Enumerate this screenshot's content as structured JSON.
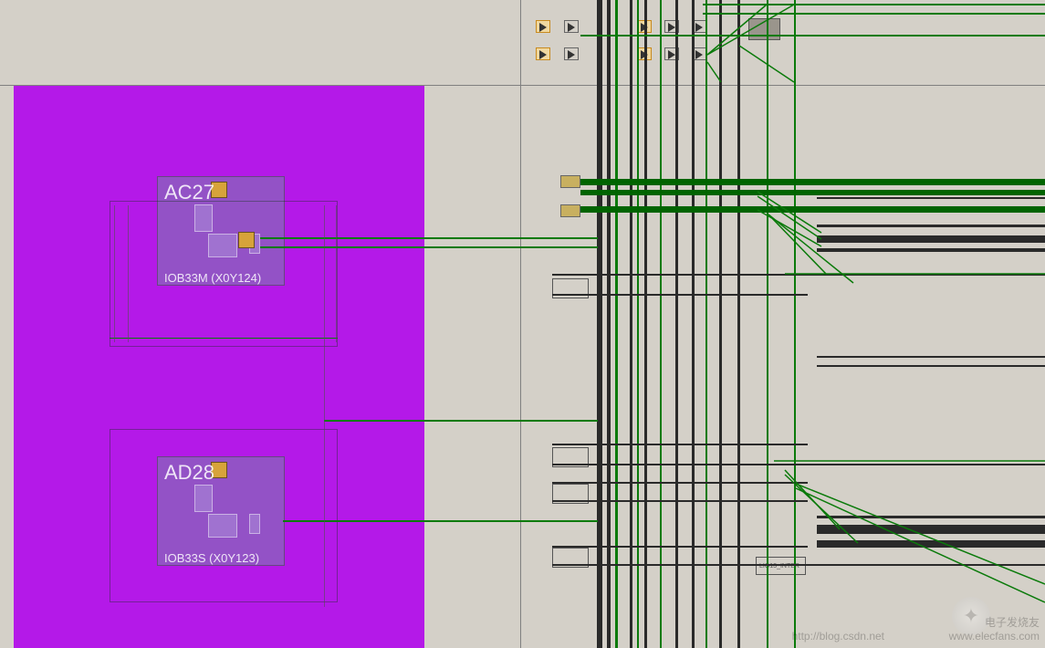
{
  "iob_tiles": [
    {
      "pin": "AC27",
      "site": "IOB33M (X0Y124)"
    },
    {
      "pin": "AD28",
      "site": "IOB33S (X0Y123)"
    }
  ],
  "interconnect_label": "LIO13_INTER",
  "watermark": {
    "line1": "电子发烧友",
    "line2": "www.elecfans.com",
    "line3": "http://blog.csdn.net"
  }
}
